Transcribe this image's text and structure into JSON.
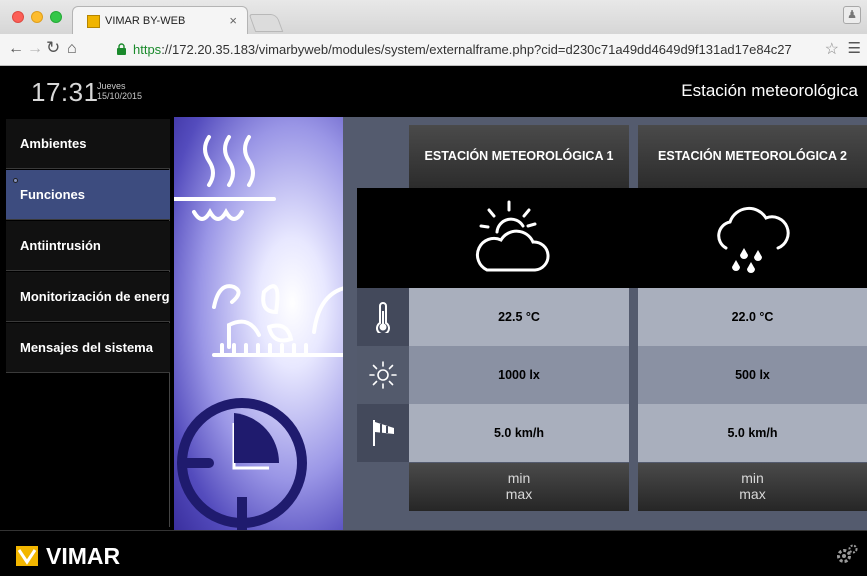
{
  "browser": {
    "tab_title": "VIMAR BY-WEB",
    "tab_close": "×",
    "url_scheme": "https",
    "url_rest": "://172.20.35.183/vimarbyweb/modules/system/externalframe.php?cid=d230c71a49dd4649d9f131ad17e84c27"
  },
  "header": {
    "time": "17:31",
    "day": "Jueves",
    "date": "15/10/2015",
    "title": "Estación meteorológica"
  },
  "sidebar": {
    "items": [
      {
        "label": "Ambientes"
      },
      {
        "label": "Funciones"
      },
      {
        "label": "Antiintrusión"
      },
      {
        "label": "Monitorización de energía"
      },
      {
        "label": "Mensajes del sistema"
      }
    ]
  },
  "stations": [
    {
      "name": "ESTACIÓN METEOROLÓGICA 1",
      "weather_icon": "partly-cloudy-icon",
      "temperature": "22.5 °C",
      "light": "1000 lx",
      "wind": "5.0 km/h",
      "min_label": "min",
      "max_label": "max"
    },
    {
      "name": "ESTACIÓN METEOROLÓGICA 2",
      "weather_icon": "rain-cloud-icon",
      "temperature": "22.0 °C",
      "light": "500 lx",
      "wind": "5.0 km/h",
      "min_label": "min",
      "max_label": "max"
    }
  ],
  "row_icons": [
    "thermometer-icon",
    "light-sun-icon",
    "wind-sock-icon"
  ],
  "footer": {
    "brand": "VIMAR"
  },
  "colors": {
    "active_menu": "#3d4c7f",
    "banner_blue": "#3a2f9e",
    "logo_yellow": "#f7c400",
    "row_light": "#a9afbd",
    "row_dark": "#8a91a3"
  }
}
